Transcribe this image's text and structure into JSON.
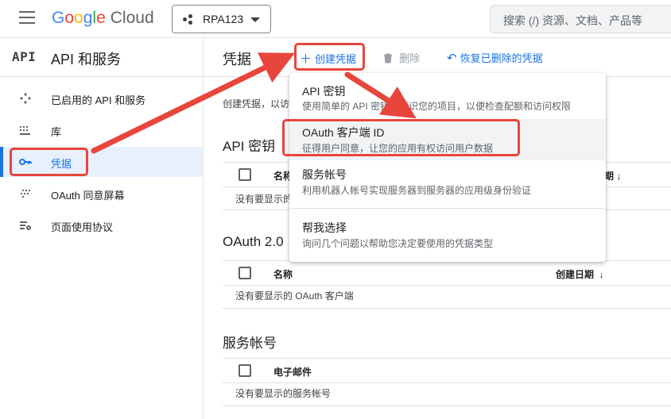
{
  "topbar": {
    "logo_google": [
      "G",
      "o",
      "o",
      "g",
      "l",
      "e"
    ],
    "logo_cloud": "Cloud",
    "project_name": "RPA123",
    "search_placeholder": "搜索 (/) 资源、文档、产品等"
  },
  "sidebar": {
    "header_mark": "API",
    "header_title": "API 和服务",
    "items": [
      {
        "label": "已启用的 API 和服务",
        "icon": "api-icon"
      },
      {
        "label": "库",
        "icon": "library-icon"
      },
      {
        "label": "凭据",
        "icon": "key-icon",
        "active": true
      },
      {
        "label": "OAuth 同意屏幕",
        "icon": "consent-icon"
      },
      {
        "label": "页面使用协议",
        "icon": "settings-list-icon"
      }
    ]
  },
  "main": {
    "title": "凭据",
    "actions": {
      "create": "创建凭据",
      "delete": "删除",
      "restore": "恢复已删除的凭据"
    },
    "intro": "创建凭据，以访",
    "sections": {
      "api_keys": {
        "title": "API 密钥",
        "col_name": "名称",
        "col_date_tail": "期",
        "empty": "没有要显示的"
      },
      "oauth": {
        "title": "OAuth 2.0",
        "col_name": "名称",
        "col_date": "创建日期",
        "empty": "没有要显示的 OAuth 客户端"
      },
      "service_accounts": {
        "title": "服务帐号",
        "col_email": "电子邮件",
        "empty": "没有要显示的服务帐号"
      }
    }
  },
  "menu": {
    "items": [
      {
        "title": "API 密钥",
        "desc": "使用简单的 API 密钥来标识您的项目，以便检查配额和访问权限"
      },
      {
        "title": "OAuth 客户端 ID",
        "desc": "征得用户同意，让您的应用有权访问用户数据"
      },
      {
        "title": "服务帐号",
        "desc": "利用机器人帐号实现服务器到服务器的应用级身份验证"
      },
      {
        "title": "帮我选择",
        "desc": "询问几个问题以帮助您决定要使用的凭据类型"
      }
    ]
  },
  "colors": {
    "accent": "#1a73e8",
    "annotation": "#e8453c"
  }
}
